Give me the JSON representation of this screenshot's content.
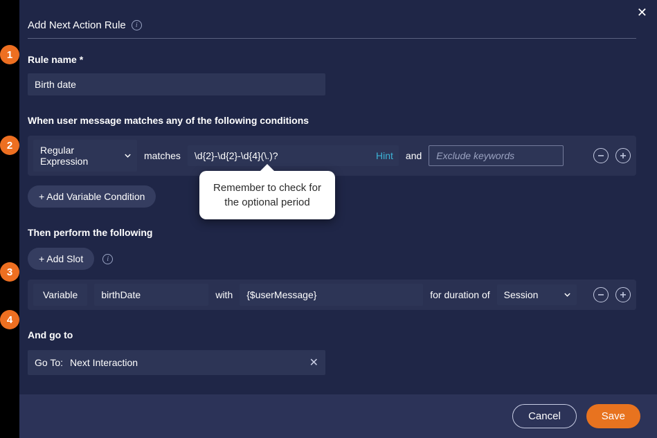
{
  "header": {
    "title": "Add Next Action Rule"
  },
  "ruleName": {
    "label": "Rule name *",
    "value": "Birth date"
  },
  "conditions": {
    "label": "When user message matches any of the following conditions",
    "matchType": "Regular Expression",
    "matchesLabel": "matches",
    "pattern": "\\d{2}-\\d{2}-\\d{4}(\\.)?",
    "hintLabel": "Hint",
    "andLabel": "and",
    "excludePlaceholder": "Exclude keywords",
    "addVariableCondition": "+ Add Variable Condition"
  },
  "tooltip": "Remember to check for the optional period",
  "actions": {
    "label": "Then perform the following",
    "addSlot": "+ Add Slot",
    "slot": {
      "typeLabel": "Variable",
      "name": "birthDate",
      "withLabel": "with",
      "value": "{$userMessage}",
      "durationLabel": "for duration of",
      "duration": "Session"
    }
  },
  "goto": {
    "label": "And go to",
    "prefix": "Go To:",
    "value": "Next Interaction"
  },
  "footer": {
    "cancel": "Cancel",
    "save": "Save"
  },
  "steps": [
    "1",
    "2",
    "3",
    "4"
  ]
}
